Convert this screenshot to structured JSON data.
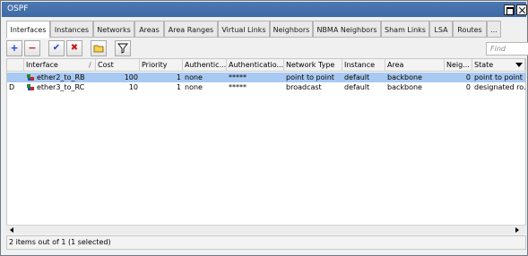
{
  "window": {
    "title": "OSPF"
  },
  "tabs": [
    {
      "label": "Interfaces"
    },
    {
      "label": "Instances"
    },
    {
      "label": "Networks"
    },
    {
      "label": "Areas"
    },
    {
      "label": "Area Ranges"
    },
    {
      "label": "Virtual Links"
    },
    {
      "label": "Neighbors"
    },
    {
      "label": "NBMA Neighbors"
    },
    {
      "label": "Sham Links"
    },
    {
      "label": "LSA"
    },
    {
      "label": "Routes"
    },
    {
      "label": "..."
    }
  ],
  "toolbar": {
    "add_icon": "+",
    "remove_icon": "−",
    "enable_icon": "✔",
    "disable_icon": "✖",
    "comment_icon": "folder-icon",
    "filter_icon": "filter-icon",
    "find_placeholder": "Find"
  },
  "table": {
    "headers": [
      "Interface",
      "Cost",
      "Priority",
      "Authentic...",
      "Authenticatio...",
      "Network Type",
      "Instance",
      "Area",
      "Neig...",
      "State"
    ],
    "sort_indicator": "/",
    "rows": [
      {
        "flag": "",
        "interface": "ether2_to_RB",
        "cost": "100",
        "priority": "1",
        "auth": "none",
        "auth_key": "*****",
        "network_type": "point to point",
        "instance": "default",
        "area": "backbone",
        "neighbors": "0",
        "state": "point to point",
        "selected": true
      },
      {
        "flag": "D",
        "interface": "ether3_to_RC",
        "cost": "10",
        "priority": "1",
        "auth": "none",
        "auth_key": "*****",
        "network_type": "broadcast",
        "instance": "default",
        "area": "backbone",
        "neighbors": "0",
        "state": "designated ro...",
        "selected": false
      }
    ]
  },
  "status": {
    "text": "2 items out of 1 (1 selected)"
  },
  "colors": {
    "title_bar": "#4470ab",
    "selected_row": "#a8c9f1",
    "add": "#1b46c9",
    "remove": "#c81717"
  }
}
